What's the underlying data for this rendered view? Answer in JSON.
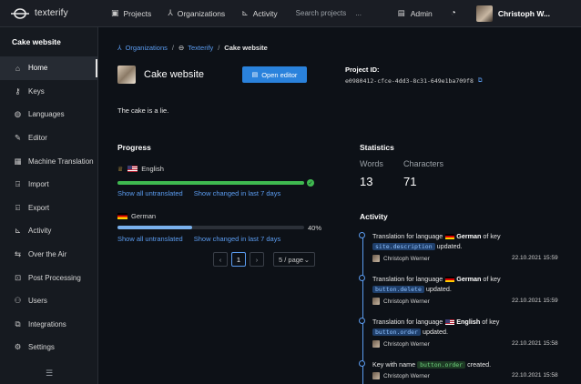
{
  "app": {
    "name": "texterify"
  },
  "topnav": {
    "projects": "Projects",
    "organizations": "Organizations",
    "activity": "Activity",
    "search_placeholder": "Search projects",
    "search_more": "...",
    "admin": "Admin",
    "user_name": "Christoph W..."
  },
  "sidebar": {
    "project_name": "Cake website",
    "items": [
      {
        "label": "Home",
        "icon": "home-icon",
        "active": true
      },
      {
        "label": "Keys",
        "icon": "key-icon"
      },
      {
        "label": "Languages",
        "icon": "globe-icon"
      },
      {
        "label": "Editor",
        "icon": "pencil-icon"
      },
      {
        "label": "Machine Translation",
        "icon": "robot-icon"
      },
      {
        "label": "Import",
        "icon": "import-icon"
      },
      {
        "label": "Export",
        "icon": "export-icon"
      },
      {
        "label": "Activity",
        "icon": "activity-icon"
      },
      {
        "label": "Over the Air",
        "icon": "ota-icon"
      },
      {
        "label": "Post Processing",
        "icon": "post-processing-icon"
      },
      {
        "label": "Users",
        "icon": "users-icon"
      },
      {
        "label": "Integrations",
        "icon": "integrations-icon"
      },
      {
        "label": "Settings",
        "icon": "settings-icon"
      }
    ]
  },
  "breadcrumb": {
    "organizations": "Organizations",
    "org": "Texterify",
    "current": "Cake website"
  },
  "project": {
    "title": "Cake website",
    "open_editor": "Open editor",
    "id_label": "Project ID:",
    "id_value": "e0980412-cfce-4dd3-8c31-649e1ba709f8",
    "description": "The cake is a lie."
  },
  "progress": {
    "heading": "Progress",
    "languages": [
      {
        "name": "English",
        "flag": "us",
        "base": true,
        "progress": 1.0,
        "complete": true,
        "show_untranslated": "Show all untranslated",
        "show_changed": "Show changed in last 7 days"
      },
      {
        "name": "German",
        "flag": "de",
        "base": false,
        "progress": 0.4,
        "percent_label": "40%",
        "show_untranslated": "Show all untranslated",
        "show_changed": "Show changed in last 7 days"
      }
    ],
    "colors": {
      "complete": "#3fb950",
      "partial": "#79b0ec",
      "track": "#2b3038"
    },
    "pager": {
      "page": "1",
      "per_page": "5 / page"
    }
  },
  "statistics": {
    "heading": "Statistics",
    "words_label": "Words",
    "words_value": "13",
    "characters_label": "Characters",
    "characters_value": "71"
  },
  "activity": {
    "heading": "Activity",
    "items": [
      {
        "pre": "Translation for language",
        "lang": "German",
        "flag": "de",
        "mid": "of key",
        "key": "site.description",
        "post": "updated.",
        "author": "Christoph Werner",
        "time": "22.10.2021 15:59"
      },
      {
        "pre": "Translation for language",
        "lang": "German",
        "flag": "de",
        "mid": "of key",
        "key": "button.delete",
        "post": "updated.",
        "author": "Christoph Werner",
        "time": "22.10.2021 15:59"
      },
      {
        "pre": "Translation for language",
        "lang": "English",
        "flag": "us",
        "mid": "of key",
        "key": "button.order",
        "post": "updated.",
        "author": "Christoph Werner",
        "time": "22.10.2021 15:58"
      },
      {
        "pre": "Key with name",
        "key": "button.order",
        "post": "created.",
        "author": "Christoph Werner",
        "time": "22.10.2021 15:58"
      }
    ]
  }
}
